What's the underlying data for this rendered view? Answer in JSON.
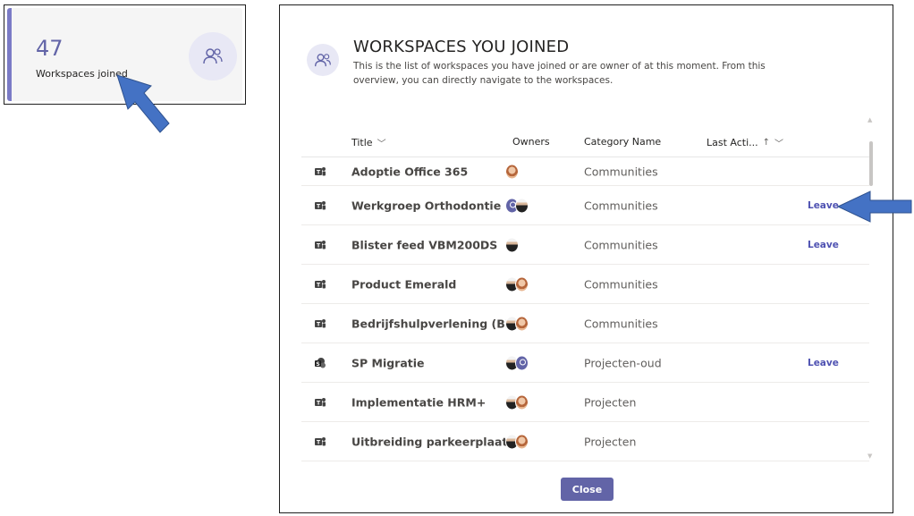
{
  "card": {
    "count": "47",
    "label": "Workspaces joined"
  },
  "dialog": {
    "title": "WORKSPACES YOU JOINED",
    "description": "This is the list of workspaces you have joined or are owner of at this moment. From this overview, you can directly navigate to the workspaces.",
    "columns": {
      "title": "Title",
      "owners": "Owners",
      "category": "Category Name",
      "last_activity": "Last Acti..."
    },
    "sort_indicator": "↑",
    "close_label": "Close"
  },
  "rows": [
    {
      "title": "Adoptie Office 365",
      "category": "Communities",
      "leave": "",
      "icon": "teams-icon",
      "owners": [
        "woman"
      ]
    },
    {
      "title": "Werkgroep Orthodontie",
      "category": "Communities",
      "leave": "Leave",
      "icon": "teams-icon",
      "owners": [
        "purple",
        "man"
      ]
    },
    {
      "title": "Blister feed VBM200DS",
      "category": "Communities",
      "leave": "Leave",
      "icon": "teams-icon",
      "owners": [
        "man"
      ]
    },
    {
      "title": "Product Emerald",
      "category": "Communities",
      "leave": "",
      "icon": "teams-icon",
      "owners": [
        "man",
        "woman"
      ]
    },
    {
      "title": "Bedrijfshulpverlening (BHV)",
      "category": "Communities",
      "leave": "",
      "icon": "teams-icon",
      "owners": [
        "man",
        "woman"
      ]
    },
    {
      "title": "SP Migratie",
      "category": "Projecten-oud",
      "leave": "Leave",
      "icon": "sharepoint-icon",
      "owners": [
        "man",
        "purple"
      ]
    },
    {
      "title": "Implementatie HRM+",
      "category": "Projecten",
      "leave": "",
      "icon": "teams-icon",
      "owners": [
        "man",
        "woman"
      ]
    },
    {
      "title": "Uitbreiding parkeerplaats",
      "category": "Projecten",
      "leave": "",
      "icon": "teams-icon",
      "owners": [
        "man",
        "woman"
      ]
    }
  ],
  "colors": {
    "accent": "#6264a7",
    "arrow": "#4472c4"
  }
}
